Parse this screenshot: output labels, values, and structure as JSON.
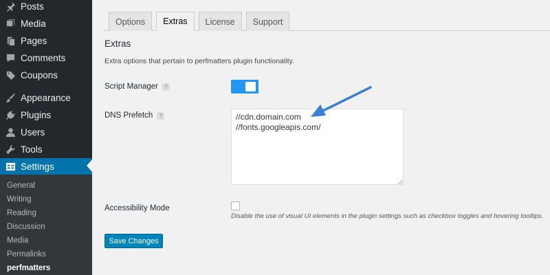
{
  "sidebar": {
    "items": [
      {
        "label": "Posts",
        "icon": "pin-icon"
      },
      {
        "label": "Media",
        "icon": "media-icon"
      },
      {
        "label": "Pages",
        "icon": "pages-icon"
      },
      {
        "label": "Comments",
        "icon": "comment-icon"
      },
      {
        "label": "Coupons",
        "icon": "tag-icon"
      },
      {
        "label": "Appearance",
        "icon": "brush-icon"
      },
      {
        "label": "Plugins",
        "icon": "plug-icon"
      },
      {
        "label": "Users",
        "icon": "user-icon"
      },
      {
        "label": "Tools",
        "icon": "wrench-icon"
      },
      {
        "label": "Settings",
        "icon": "settings-icon"
      }
    ],
    "submenu": [
      "General",
      "Writing",
      "Reading",
      "Discussion",
      "Media",
      "Permalinks",
      "perfmatters"
    ],
    "accent": "#0073aa"
  },
  "tabs": [
    "Options",
    "Extras",
    "License",
    "Support"
  ],
  "section": {
    "title": "Extras",
    "description": "Extra options that pertain to perfmatters plugin functionality."
  },
  "fields": {
    "script_manager": {
      "label": "Script Manager",
      "help": "?",
      "enabled": true
    },
    "dns_prefetch": {
      "label": "DNS Prefetch",
      "help": "?",
      "lines": [
        "//cdn.domain.com",
        "//fonts.googleapis.com/"
      ]
    },
    "accessibility": {
      "label": "Accessibility Mode",
      "checked": false,
      "note": "Disable the use of visual UI elements in the plugin settings such as checkbox toggles and hovering tooltips."
    }
  },
  "save_label": "Save Changes",
  "colors": {
    "toggle_on": "#2196f3",
    "button": "#0085ba",
    "arrow": "#3a7fd4"
  }
}
